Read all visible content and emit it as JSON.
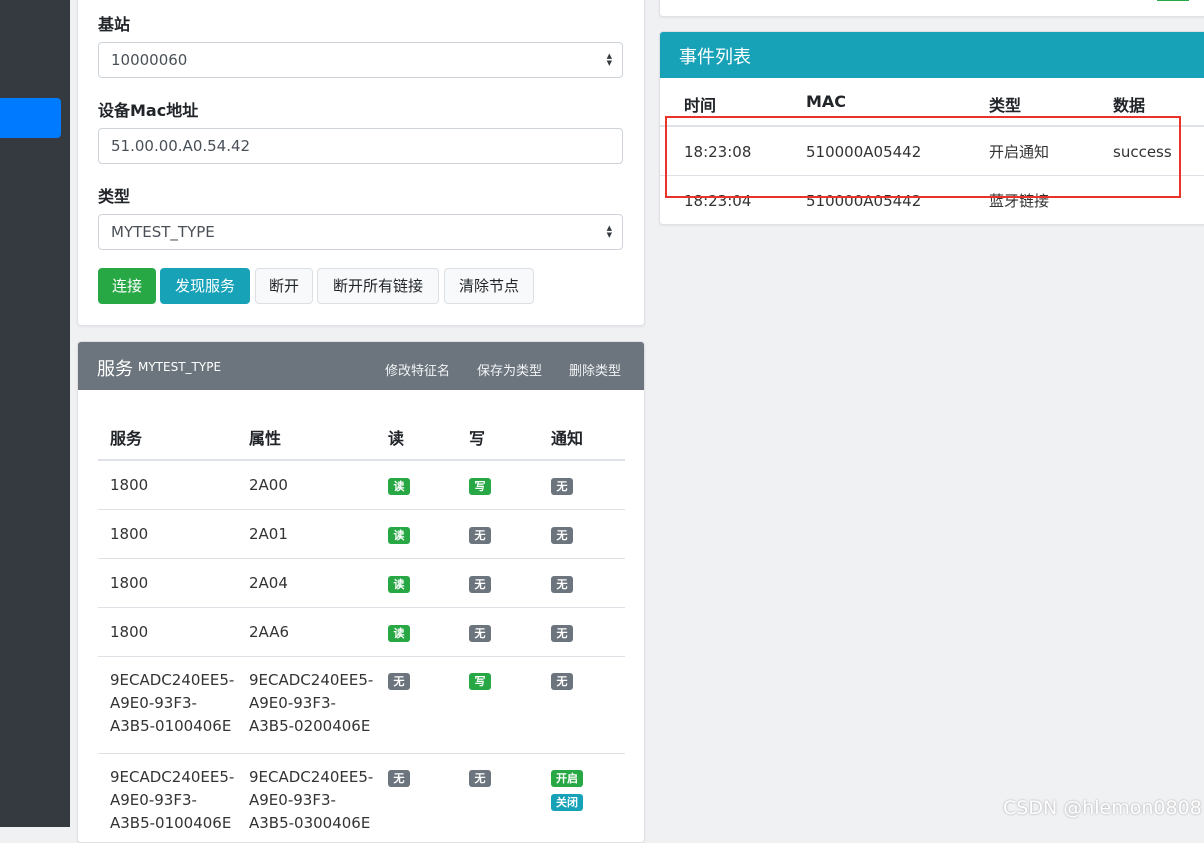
{
  "form": {
    "station_label": "基站",
    "station_value": "10000060",
    "mac_label": "设备Mac地址",
    "mac_value": "51.00.00.A0.54.42",
    "type_label": "类型",
    "type_value": "MYTEST_TYPE",
    "buttons": {
      "connect": "连接",
      "discover": "发现服务",
      "disconnect": "断开",
      "disconnect_all": "断开所有链接",
      "clear": "清除节点"
    }
  },
  "services": {
    "title": "服务",
    "subtitle": "MYTEST_TYPE",
    "actions": {
      "rename": "修改特征名",
      "save": "保存为类型",
      "delete": "删除类型"
    },
    "headers": {
      "service": "服务",
      "property": "属性",
      "read": "读",
      "write": "写",
      "notify": "通知"
    },
    "rows": [
      {
        "service": "1800",
        "property": "2A00",
        "read": "读",
        "write": "写",
        "notify": "无"
      },
      {
        "service": "1800",
        "property": "2A01",
        "read": "读",
        "write": "无",
        "notify": "无"
      },
      {
        "service": "1800",
        "property": "2A04",
        "read": "读",
        "write": "无",
        "notify": "无"
      },
      {
        "service": "1800",
        "property": "2AA6",
        "read": "读",
        "write": "无",
        "notify": "无"
      },
      {
        "service": [
          "9ECADC240EE5-",
          "A9E0-93F3-",
          "A3B5-0100406E"
        ],
        "property": [
          "9ECADC240EE5-",
          "A9E0-93F3-",
          "A3B5-0200406E"
        ],
        "read": "无",
        "write": "写",
        "notify": "无"
      },
      {
        "service": [
          "9ECADC240EE5-",
          "A9E0-93F3-",
          "A3B5-0100406E"
        ],
        "property": [
          "9ECADC240EE5-",
          "A9E0-93F3-",
          "A3B5-0300406E"
        ],
        "read": "无",
        "write": "无",
        "notify_on": "开启",
        "notify_off": "关闭"
      }
    ]
  },
  "events": {
    "title": "事件列表",
    "headers": {
      "time": "时间",
      "mac": "MAC",
      "type": "类型",
      "data": "数据"
    },
    "rows": [
      {
        "time": "18:23:08",
        "mac": "510000A05442",
        "type": "开启通知",
        "data": "success"
      },
      {
        "time": "18:23:04",
        "mac": "510000A05442",
        "type": "蓝牙链接",
        "data": ""
      }
    ]
  },
  "watermark": "CSDN @hlemon0808",
  "colors": {
    "sidebar": "#343a40",
    "active": "#007bff",
    "success": "#28a745",
    "info": "#17a2b8",
    "secondary": "#6c757d",
    "highlight": "#e8332d"
  }
}
